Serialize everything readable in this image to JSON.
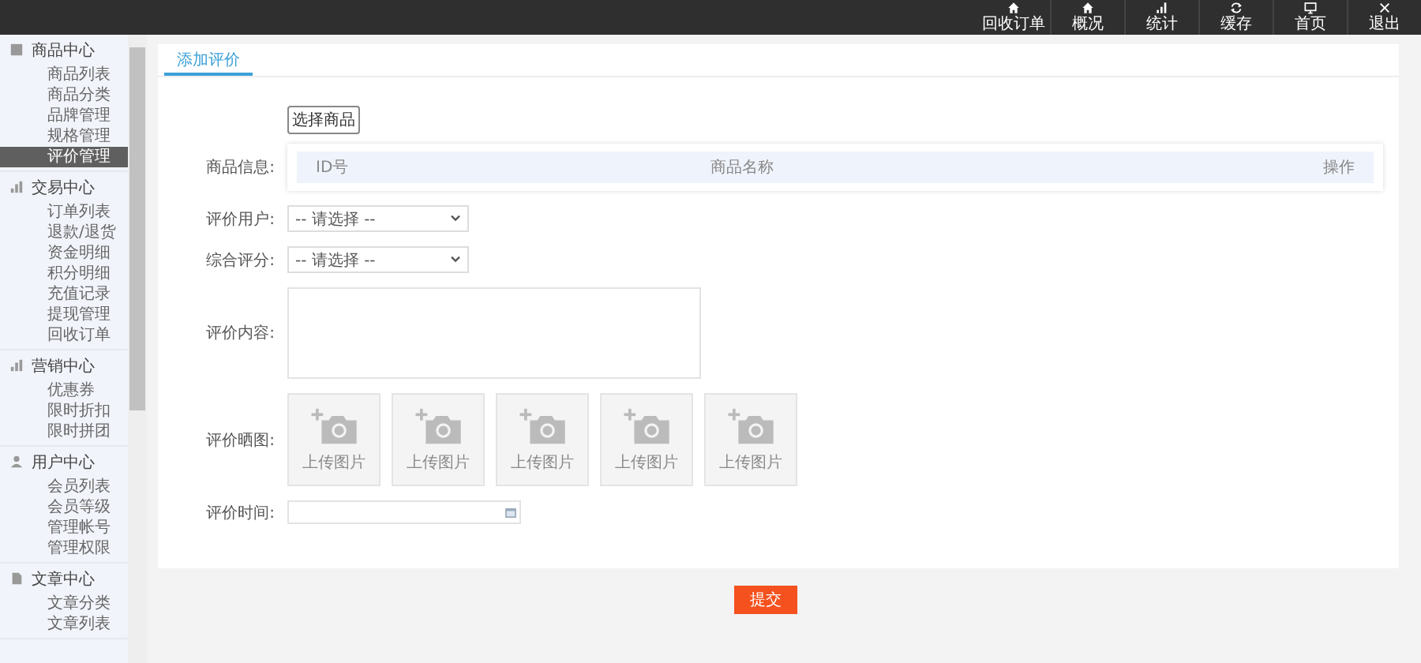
{
  "top_nav": [
    {
      "label": "回收订单"
    },
    {
      "label": "概况"
    },
    {
      "label": "统计"
    },
    {
      "label": "缓存"
    },
    {
      "label": "首页"
    },
    {
      "label": "退出"
    }
  ],
  "sidebar": {
    "groups": [
      {
        "title": "商品中心",
        "items": [
          {
            "label": "商品列表",
            "selected": false
          },
          {
            "label": "商品分类",
            "selected": false
          },
          {
            "label": "品牌管理",
            "selected": false
          },
          {
            "label": "规格管理",
            "selected": false
          },
          {
            "label": "评价管理",
            "selected": true
          }
        ]
      },
      {
        "title": "交易中心",
        "items": [
          {
            "label": "订单列表",
            "selected": false
          },
          {
            "label": "退款/退货",
            "selected": false
          },
          {
            "label": "资金明细",
            "selected": false
          },
          {
            "label": "积分明细",
            "selected": false
          },
          {
            "label": "充值记录",
            "selected": false
          },
          {
            "label": "提现管理",
            "selected": false
          },
          {
            "label": "回收订单",
            "selected": false
          }
        ]
      },
      {
        "title": "营销中心",
        "items": [
          {
            "label": "优惠券",
            "selected": false
          },
          {
            "label": "限时折扣",
            "selected": false
          },
          {
            "label": "限时拼团",
            "selected": false
          }
        ]
      },
      {
        "title": "用户中心",
        "items": [
          {
            "label": "会员列表",
            "selected": false
          },
          {
            "label": "会员等级",
            "selected": false
          },
          {
            "label": "管理帐号",
            "selected": false
          },
          {
            "label": "管理权限",
            "selected": false
          }
        ]
      },
      {
        "title": "文章中心",
        "items": [
          {
            "label": "文章分类",
            "selected": false
          },
          {
            "label": "文章列表",
            "selected": false
          }
        ]
      }
    ]
  },
  "tabs": [
    {
      "label": "添加评价",
      "selected": true
    }
  ],
  "form": {
    "select_goods_button": "选择商品",
    "goods_info": {
      "label": "商品信息:",
      "columns": [
        "ID号",
        "商品名称",
        "操作"
      ]
    },
    "user": {
      "label": "评价用户:",
      "value": "-- 请选择 --"
    },
    "rating": {
      "label": "综合评分:",
      "value": "-- 请选择 --"
    },
    "content": {
      "label": "评价内容:"
    },
    "images": {
      "label": "评价晒图:",
      "slots": [
        "上传图片",
        "上传图片",
        "上传图片",
        "上传图片",
        "上传图片"
      ]
    },
    "time": {
      "label": "评价时间:"
    }
  },
  "submit_button": "提交"
}
